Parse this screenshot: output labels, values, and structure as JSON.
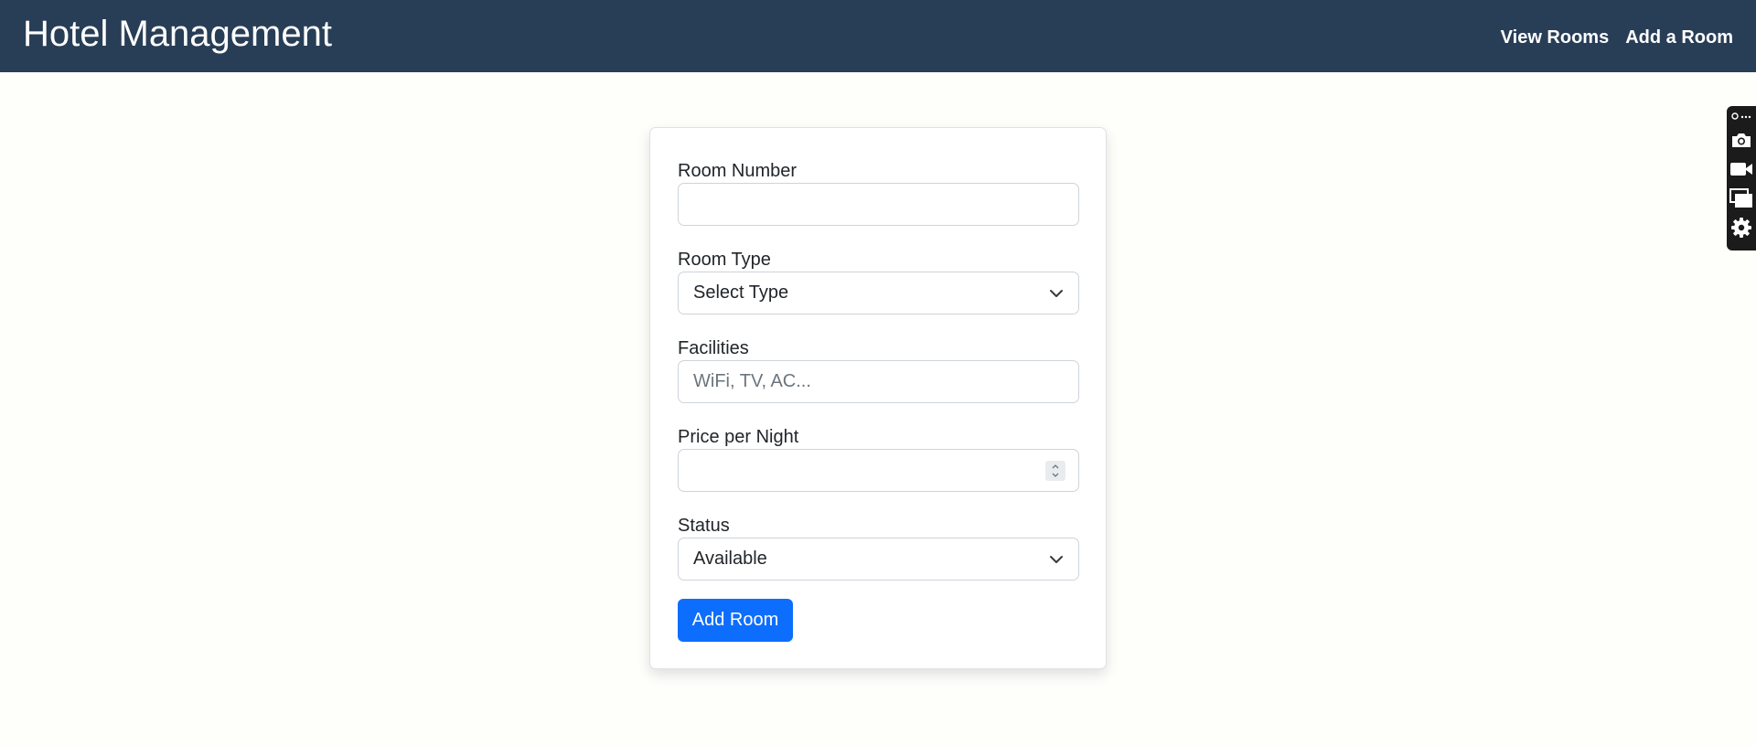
{
  "navbar": {
    "brand": "Hotel Management",
    "links": [
      {
        "label": "View Rooms"
      },
      {
        "label": "Add a Room"
      }
    ]
  },
  "form": {
    "room_number": {
      "label": "Room Number",
      "value": "",
      "placeholder": ""
    },
    "room_type": {
      "label": "Room Type",
      "selected": "Select Type"
    },
    "facilities": {
      "label": "Facilities",
      "value": "",
      "placeholder": "WiFi, TV, AC..."
    },
    "price": {
      "label": "Price per Night",
      "value": "",
      "placeholder": ""
    },
    "status": {
      "label": "Status",
      "selected": "Available"
    },
    "submit_label": "Add Room"
  },
  "colors": {
    "navbar_bg": "#283e56",
    "primary": "#0d6efd",
    "page_bg": "#fefefb"
  },
  "side_toolbar": {
    "icons": [
      "link-more-icon",
      "camera-icon",
      "video-camera-icon",
      "windows-icon",
      "gear-icon"
    ]
  }
}
